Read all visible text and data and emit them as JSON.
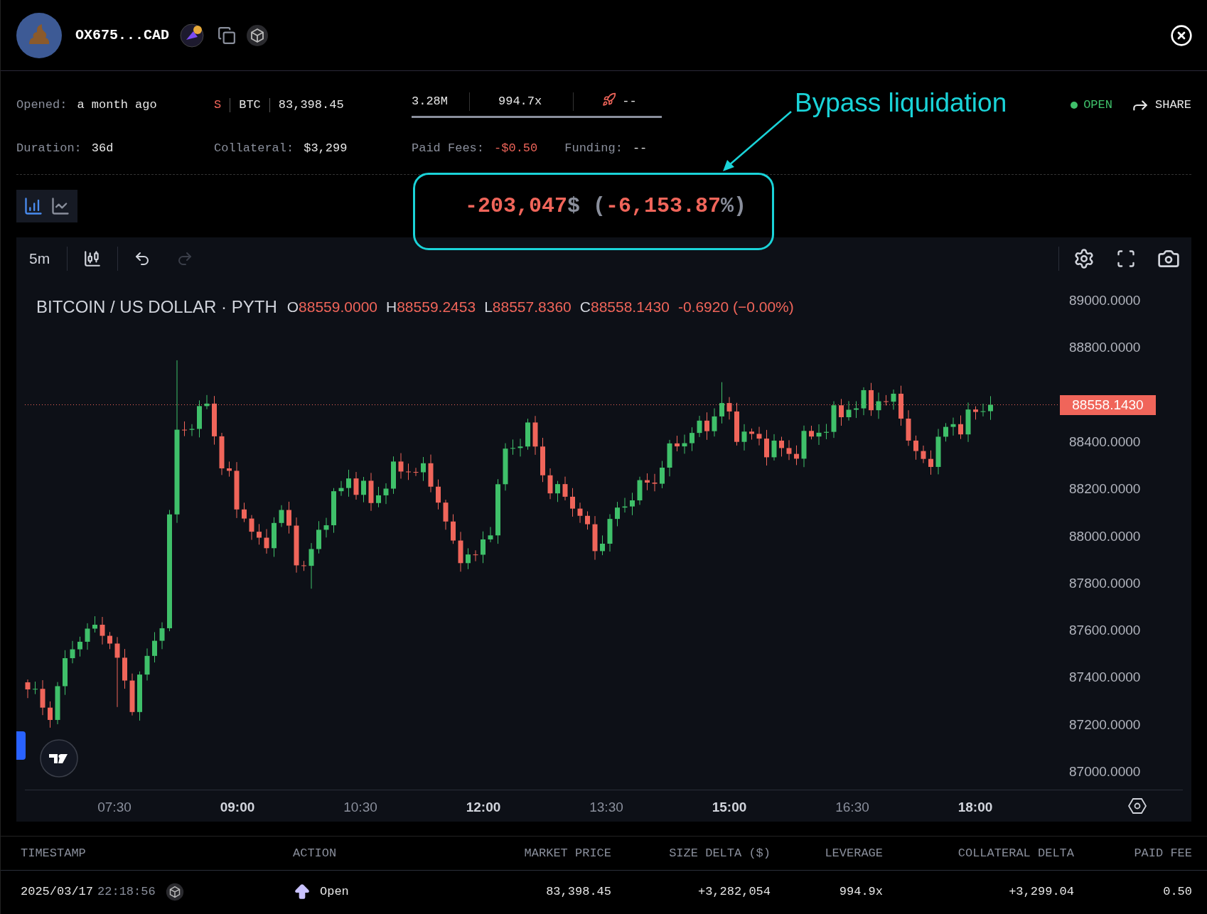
{
  "header": {
    "address": "OX675...CAD"
  },
  "info": {
    "opened_label": "Opened:",
    "opened_value": "a month ago",
    "short": true,
    "side": "S",
    "asset": "BTC",
    "entry_price": "83,398.45",
    "size": "3.28M",
    "leverage": "994.7x",
    "liquidation": "--",
    "duration_label": "Duration:",
    "duration_value": "36d",
    "collateral_label": "Collateral:",
    "collateral_value": "$3,299",
    "fees_label": "Paid Fees:",
    "fees_value": "-$0.50",
    "funding_label": "Funding:",
    "funding_value": "--",
    "status": {
      "label": "OPEN",
      "color": "#3fc06a"
    },
    "share": "SHARE"
  },
  "annotation": {
    "text": "Bypass liquidation"
  },
  "chart_types": [
    {
      "kind": "bars",
      "selected": true
    },
    {
      "kind": "line",
      "selected": false
    }
  ],
  "pnl": [
    {
      "text": "-203,047",
      "color": "#f0655a"
    },
    {
      "text": "$",
      "color": "#8a8f9c"
    },
    {
      "text": " (",
      "color": "#8a8f9c"
    },
    {
      "text": "-6,153.87",
      "color": "#f0655a"
    },
    {
      "text": "%)",
      "color": "#8a8f9c"
    }
  ],
  "chart": {
    "interval": "5m",
    "history": [
      {
        "kind": "undo",
        "disabled": false
      },
      {
        "kind": "redo",
        "disabled": true
      }
    ],
    "legend": {
      "title": "BITCOIN / US DOLLAR · PYTH",
      "ohlc": [
        {
          "label": "O",
          "value": "88559.0000"
        },
        {
          "label": "H",
          "value": "88559.2453"
        },
        {
          "label": "L",
          "value": "88557.8360"
        },
        {
          "label": "C",
          "value": "88558.1430"
        }
      ],
      "change": "-0.6920 (−0.00%)"
    },
    "price_labels": [
      "89000.0000",
      "88800.0000",
      "88400.0000",
      "88200.0000",
      "88000.0000",
      "87800.0000",
      "87600.0000",
      "87400.0000",
      "87200.0000",
      "87000.0000"
    ],
    "last_price": "88558.1430",
    "time_labels": [
      {
        "label": "07:30",
        "major": false
      },
      {
        "label": "09:00",
        "major": true
      },
      {
        "label": "10:30",
        "major": false
      },
      {
        "label": "12:00",
        "major": true
      },
      {
        "label": "13:30",
        "major": false
      },
      {
        "label": "15:00",
        "major": true
      },
      {
        "label": "16:30",
        "major": false
      },
      {
        "label": "18:00",
        "major": true
      }
    ]
  },
  "table": {
    "columns": [
      "TIMESTAMP",
      "ACTION",
      "MARKET PRICE",
      "SIZE DELTA ($)",
      "LEVERAGE",
      "COLLATERAL DELTA",
      "PAID FEE"
    ],
    "rows": [
      {
        "date": "2025/03/17",
        "time": "22:18:56",
        "action": "Open",
        "market_price": "83,398.45",
        "size_delta": "+3,282,054",
        "leverage": "994.9x",
        "collateral_delta": "+3,299.04",
        "paid_fee": "0.50"
      }
    ]
  }
}
